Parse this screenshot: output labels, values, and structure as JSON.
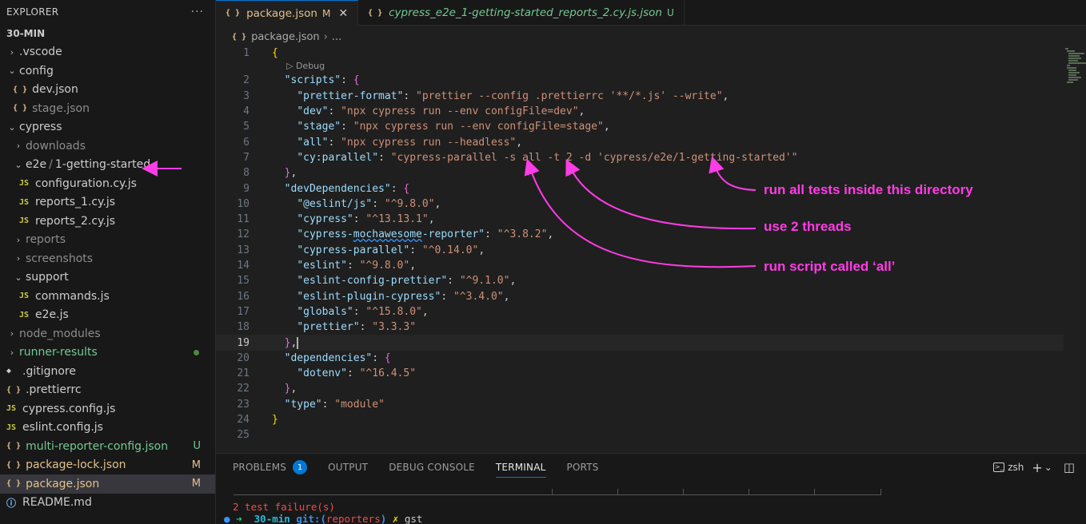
{
  "sidebar": {
    "title": "EXPLORER",
    "more": "···",
    "root": "30-MIN",
    "items": [
      {
        "label": ".vscode",
        "type": "folder",
        "depth": 0,
        "open": false,
        "style": "normal"
      },
      {
        "label": "config",
        "type": "folder",
        "depth": 0,
        "open": true,
        "style": "normal"
      },
      {
        "label": "dev.json",
        "type": "json",
        "depth": 1,
        "style": "normal"
      },
      {
        "label": "stage.json",
        "type": "json",
        "depth": 1,
        "style": "dim"
      },
      {
        "label": "cypress",
        "type": "folder",
        "depth": 0,
        "open": true,
        "style": "normal"
      },
      {
        "label": "downloads",
        "type": "folder",
        "depth": 1,
        "open": false,
        "style": "dim"
      },
      {
        "label": "e2e",
        "label2": "1-getting-started",
        "sep": "/",
        "type": "folder",
        "depth": 1,
        "open": true,
        "style": "normal"
      },
      {
        "label": "configuration.cy.js",
        "type": "js",
        "depth": 2,
        "style": "normal"
      },
      {
        "label": "reports_1.cy.js",
        "type": "js",
        "depth": 2,
        "style": "normal"
      },
      {
        "label": "reports_2.cy.js",
        "type": "js",
        "depth": 2,
        "style": "normal"
      },
      {
        "label": "reports",
        "type": "folder",
        "depth": 1,
        "open": false,
        "style": "dim"
      },
      {
        "label": "screenshots",
        "type": "folder",
        "depth": 1,
        "open": false,
        "style": "dim"
      },
      {
        "label": "support",
        "type": "folder",
        "depth": 1,
        "open": true,
        "style": "normal"
      },
      {
        "label": "commands.js",
        "type": "js",
        "depth": 2,
        "style": "normal"
      },
      {
        "label": "e2e.js",
        "type": "js",
        "depth": 2,
        "style": "normal"
      },
      {
        "label": "node_modules",
        "type": "folder",
        "depth": 0,
        "open": false,
        "style": "dim"
      },
      {
        "label": "runner-results",
        "type": "folder",
        "depth": 0,
        "open": false,
        "style": "untracked",
        "badge": "dot"
      },
      {
        "label": ".gitignore",
        "type": "ignore",
        "depth": 0,
        "style": "normal"
      },
      {
        "label": ".prettierrc",
        "type": "json",
        "depth": 0,
        "style": "normal"
      },
      {
        "label": "cypress.config.js",
        "type": "js",
        "depth": 0,
        "style": "normal"
      },
      {
        "label": "eslint.config.js",
        "type": "js",
        "depth": 0,
        "style": "normal"
      },
      {
        "label": "multi-reporter-config.json",
        "type": "json",
        "depth": 0,
        "style": "untracked",
        "badge": "U"
      },
      {
        "label": "package-lock.json",
        "type": "json",
        "depth": 0,
        "style": "mod",
        "badge": "M"
      },
      {
        "label": "package.json",
        "type": "json",
        "depth": 0,
        "style": "mod",
        "badge": "M",
        "selected": true
      },
      {
        "label": "README.md",
        "type": "info",
        "depth": 0,
        "style": "normal"
      }
    ]
  },
  "icons": {
    "json": "{ }",
    "js": "JS",
    "info": "ⓘ",
    "ignore": "◆",
    "chevron_open": "⌄",
    "chevron_closed": "›"
  },
  "tabs": [
    {
      "name": "package.json",
      "status": "M",
      "close": "✕",
      "active": true
    },
    {
      "name": "cypress_e2e_1-getting-started_reports_2.cy.js.json",
      "status": "U",
      "active": false
    }
  ],
  "breadcrumb": {
    "file": "package.json",
    "rest": "..."
  },
  "codelens": "▷ Debug",
  "code": {
    "current_line": 19,
    "lines": [
      {
        "n": "1",
        "t": "{"
      },
      {
        "n": "2",
        "t": "  \"scripts\": {"
      },
      {
        "n": "3",
        "t": "    \"prettier-format\": \"prettier --config .prettierrc '**/*.js' --write\","
      },
      {
        "n": "4",
        "t": "    \"dev\": \"npx cypress run --env configFile=dev\","
      },
      {
        "n": "5",
        "t": "    \"stage\": \"npx cypress run --env configFile=stage\","
      },
      {
        "n": "6",
        "t": "    \"all\": \"npx cypress run --headless\","
      },
      {
        "n": "7",
        "t": "    \"cy:parallel\": \"cypress-parallel -s all -t 2 -d 'cypress/e2e/1-getting-started'\""
      },
      {
        "n": "8",
        "t": "  },"
      },
      {
        "n": "9",
        "t": "  \"devDependencies\": {"
      },
      {
        "n": "10",
        "t": "    \"@eslint/js\": \"^9.8.0\","
      },
      {
        "n": "11",
        "t": "    \"cypress\": \"^13.13.1\","
      },
      {
        "n": "12",
        "t": "    \"cypress-mochawesome-reporter\": \"^3.8.2\","
      },
      {
        "n": "13",
        "t": "    \"cypress-parallel\": \"^0.14.0\","
      },
      {
        "n": "14",
        "t": "    \"eslint\": \"^9.8.0\","
      },
      {
        "n": "15",
        "t": "    \"eslint-config-prettier\": \"^9.1.0\","
      },
      {
        "n": "16",
        "t": "    \"eslint-plugin-cypress\": \"^3.4.0\","
      },
      {
        "n": "17",
        "t": "    \"globals\": \"^15.8.0\","
      },
      {
        "n": "18",
        "t": "    \"prettier\": \"3.3.3\""
      },
      {
        "n": "19",
        "t": "  },"
      },
      {
        "n": "20",
        "t": "  \"dependencies\": {"
      },
      {
        "n": "21",
        "t": "    \"dotenv\": \"^16.4.5\""
      },
      {
        "n": "22",
        "t": "  },"
      },
      {
        "n": "23",
        "t": "  \"type\": \"module\""
      },
      {
        "n": "24",
        "t": "}"
      },
      {
        "n": "25",
        "t": ""
      }
    ]
  },
  "annotations": {
    "dir": "run all tests inside this directory",
    "threads": "use 2 threads",
    "script": "run script called ‘all’"
  },
  "annotation_color": "#ff3ce6",
  "panel": {
    "tabs": [
      {
        "label": "PROBLEMS",
        "badge": "1"
      },
      {
        "label": "OUTPUT"
      },
      {
        "label": "DEBUG CONSOLE"
      },
      {
        "label": "TERMINAL",
        "active": true
      },
      {
        "label": "PORTS"
      }
    ],
    "shell": "zsh",
    "shell_icon": ">_",
    "add": "+",
    "dropdown": "⌄",
    "split": "◫",
    "terminal_lines": {
      "fail": "2 test failure(s)",
      "prompt_arrow": "➜",
      "dir": "30-min",
      "git": "git:(",
      "branch": "reporters",
      "git_close": ")",
      "x": "✗",
      "cmd": "gst"
    }
  }
}
